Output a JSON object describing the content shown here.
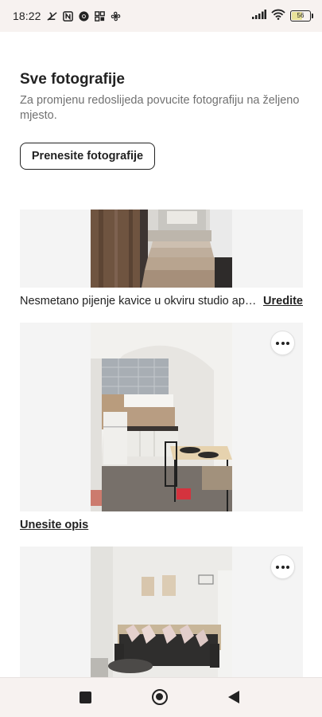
{
  "status_bar": {
    "time": "18:22",
    "left_icons": [
      "silent-mode-icon",
      "nfc-icon",
      "chrome-icon",
      "app-grid-icon",
      "fan-icon"
    ],
    "right_icons": [
      "signal-icon",
      "wifi-icon",
      "battery-icon"
    ],
    "battery_level": "56"
  },
  "header": {
    "title": "Sve fotografije",
    "subtitle": "Za promjenu redoslijeda povucite fotografiju na željeno mjesto."
  },
  "upload_button": {
    "label": "Prenesite fotografije"
  },
  "photos": [
    {
      "subject": "stairs",
      "caption": "Nesmetano pijenje kavice u okviru studio apartmana",
      "action": "Uredite"
    },
    {
      "subject": "kitchen",
      "more_menu_icon": "more-horizontal-icon",
      "action": "Unesite opis"
    },
    {
      "subject": "living-room",
      "more_menu_icon": "more-horizontal-icon"
    }
  ],
  "nav_bar": {
    "buttons": [
      "recents-square-icon",
      "home-circle-icon",
      "back-triangle-icon"
    ]
  },
  "colors": {
    "text_primary": "#222222",
    "text_secondary": "#717171",
    "card_background": "#f4f4f4",
    "system_bar_background": "#f7f2f0"
  }
}
